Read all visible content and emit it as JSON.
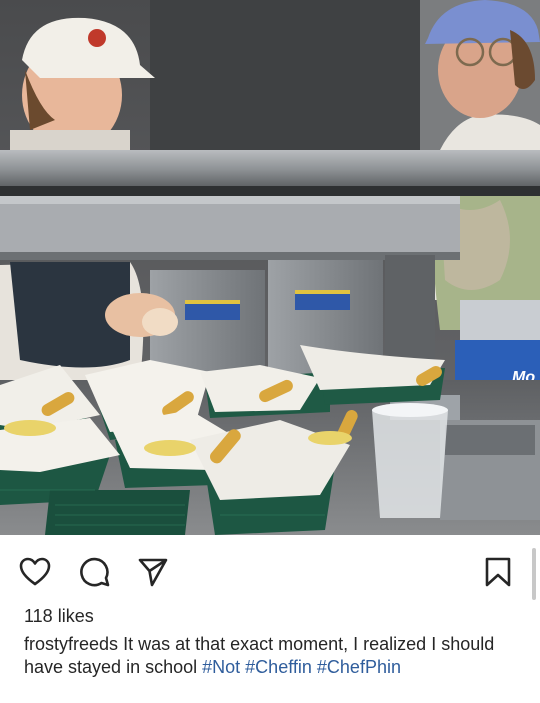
{
  "post": {
    "username": "frostyfreeds",
    "caption_text": "It was at that exact moment, I realized I should have stayed in school",
    "hashtags": [
      "#Not",
      "#Cheffin",
      "#ChefPhin"
    ],
    "likes": "118 likes"
  },
  "photo": {
    "box_label": "Mo"
  },
  "actions": {
    "like_icon": "heart-outline-icon",
    "comment_icon": "speech-bubble-icon",
    "share_icon": "paper-plane-icon",
    "save_icon": "bookmark-icon"
  }
}
